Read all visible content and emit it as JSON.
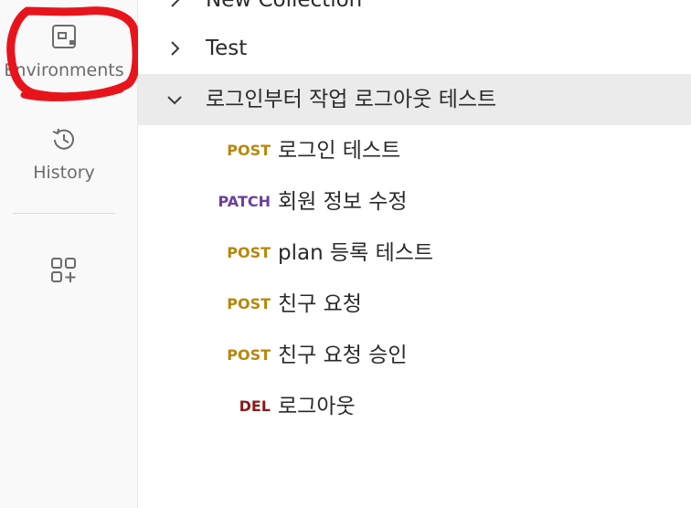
{
  "sidebar": {
    "environments_label": "Environments",
    "history_label": "History",
    "items": [
      {
        "label": "Environments",
        "icon": "environment-icon"
      },
      {
        "label": "History",
        "icon": "history-icon"
      },
      {
        "label": "",
        "icon": "add-widget-icon"
      }
    ]
  },
  "collections": [
    {
      "label": "New Collection",
      "expanded": false
    },
    {
      "label": "Test",
      "expanded": false
    },
    {
      "label": "로그인부터 작업 로그아웃 테스트",
      "expanded": true,
      "selected": true
    }
  ],
  "requests": [
    {
      "method": "POST",
      "name": "로그인 테스트"
    },
    {
      "method": "PATCH",
      "name": "회원 정보 수정"
    },
    {
      "method": "POST",
      "name": "plan 등록 테스트"
    },
    {
      "method": "POST",
      "name": "친구 요청"
    },
    {
      "method": "POST",
      "name": "친구 요청 승인"
    },
    {
      "method": "DEL",
      "name": "로그아웃"
    }
  ],
  "colors": {
    "POST": "#b8860b",
    "PATCH": "#6b3fa0",
    "DEL": "#8b1a1a",
    "annotation": "#e8141c"
  }
}
